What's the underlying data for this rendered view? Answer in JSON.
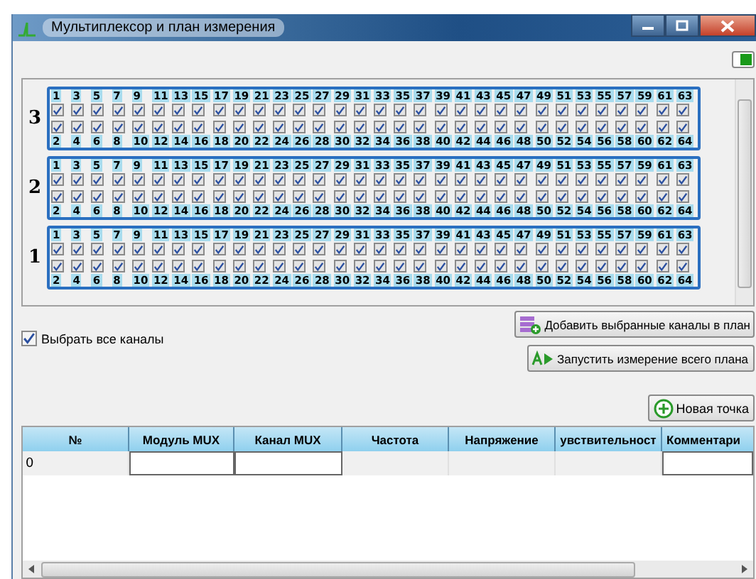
{
  "window": {
    "title": "Мультиплексор и план измерения"
  },
  "modules": [
    {
      "label": "3",
      "odd": [
        {
          "number": "1",
          "checked": true
        },
        {
          "number": "3",
          "checked": true
        },
        {
          "number": "5",
          "checked": true
        },
        {
          "number": "7",
          "checked": true
        },
        {
          "number": "9",
          "checked": true
        },
        {
          "number": "11",
          "checked": true
        },
        {
          "number": "13",
          "checked": true
        },
        {
          "number": "15",
          "checked": true
        },
        {
          "number": "17",
          "checked": true
        },
        {
          "number": "19",
          "checked": true
        },
        {
          "number": "21",
          "checked": true
        },
        {
          "number": "23",
          "checked": true
        },
        {
          "number": "25",
          "checked": true
        },
        {
          "number": "27",
          "checked": true
        },
        {
          "number": "29",
          "checked": true
        },
        {
          "number": "31",
          "checked": true
        },
        {
          "number": "33",
          "checked": true
        },
        {
          "number": "35",
          "checked": true
        },
        {
          "number": "37",
          "checked": true
        },
        {
          "number": "39",
          "checked": true
        },
        {
          "number": "41",
          "checked": true
        },
        {
          "number": "43",
          "checked": true
        },
        {
          "number": "45",
          "checked": true
        },
        {
          "number": "47",
          "checked": true
        },
        {
          "number": "49",
          "checked": true
        },
        {
          "number": "51",
          "checked": true
        },
        {
          "number": "53",
          "checked": true
        },
        {
          "number": "55",
          "checked": true
        },
        {
          "number": "57",
          "checked": true
        },
        {
          "number": "59",
          "checked": true
        },
        {
          "number": "61",
          "checked": true
        },
        {
          "number": "63",
          "checked": true
        }
      ],
      "even": [
        {
          "number": "2",
          "checked": true
        },
        {
          "number": "4",
          "checked": true
        },
        {
          "number": "6",
          "checked": true
        },
        {
          "number": "8",
          "checked": true
        },
        {
          "number": "10",
          "checked": true
        },
        {
          "number": "12",
          "checked": true
        },
        {
          "number": "14",
          "checked": true
        },
        {
          "number": "16",
          "checked": true
        },
        {
          "number": "18",
          "checked": true
        },
        {
          "number": "20",
          "checked": true
        },
        {
          "number": "22",
          "checked": true
        },
        {
          "number": "24",
          "checked": true
        },
        {
          "number": "26",
          "checked": true
        },
        {
          "number": "28",
          "checked": true
        },
        {
          "number": "30",
          "checked": true
        },
        {
          "number": "32",
          "checked": true
        },
        {
          "number": "34",
          "checked": true
        },
        {
          "number": "36",
          "checked": true
        },
        {
          "number": "38",
          "checked": true
        },
        {
          "number": "40",
          "checked": true
        },
        {
          "number": "42",
          "checked": true
        },
        {
          "number": "44",
          "checked": true
        },
        {
          "number": "46",
          "checked": true
        },
        {
          "number": "48",
          "checked": true
        },
        {
          "number": "50",
          "checked": true
        },
        {
          "number": "52",
          "checked": true
        },
        {
          "number": "54",
          "checked": true
        },
        {
          "number": "56",
          "checked": true
        },
        {
          "number": "58",
          "checked": true
        },
        {
          "number": "60",
          "checked": true
        },
        {
          "number": "62",
          "checked": true
        },
        {
          "number": "64",
          "checked": true
        }
      ]
    },
    {
      "label": "2",
      "odd": [
        {
          "number": "1",
          "checked": true
        },
        {
          "number": "3",
          "checked": true
        },
        {
          "number": "5",
          "checked": true
        },
        {
          "number": "7",
          "checked": true
        },
        {
          "number": "9",
          "checked": true
        },
        {
          "number": "11",
          "checked": true
        },
        {
          "number": "13",
          "checked": true
        },
        {
          "number": "15",
          "checked": true
        },
        {
          "number": "17",
          "checked": true
        },
        {
          "number": "19",
          "checked": true
        },
        {
          "number": "21",
          "checked": true
        },
        {
          "number": "23",
          "checked": true
        },
        {
          "number": "25",
          "checked": true
        },
        {
          "number": "27",
          "checked": true
        },
        {
          "number": "29",
          "checked": true
        },
        {
          "number": "31",
          "checked": true
        },
        {
          "number": "33",
          "checked": true
        },
        {
          "number": "35",
          "checked": true
        },
        {
          "number": "37",
          "checked": true
        },
        {
          "number": "39",
          "checked": true
        },
        {
          "number": "41",
          "checked": true
        },
        {
          "number": "43",
          "checked": true
        },
        {
          "number": "45",
          "checked": true
        },
        {
          "number": "47",
          "checked": true
        },
        {
          "number": "49",
          "checked": true
        },
        {
          "number": "51",
          "checked": true
        },
        {
          "number": "53",
          "checked": true
        },
        {
          "number": "55",
          "checked": true
        },
        {
          "number": "57",
          "checked": true
        },
        {
          "number": "59",
          "checked": true
        },
        {
          "number": "61",
          "checked": true
        },
        {
          "number": "63",
          "checked": true
        }
      ],
      "even": [
        {
          "number": "2",
          "checked": true
        },
        {
          "number": "4",
          "checked": true
        },
        {
          "number": "6",
          "checked": true
        },
        {
          "number": "8",
          "checked": true
        },
        {
          "number": "10",
          "checked": true
        },
        {
          "number": "12",
          "checked": true
        },
        {
          "number": "14",
          "checked": true
        },
        {
          "number": "16",
          "checked": true
        },
        {
          "number": "18",
          "checked": true
        },
        {
          "number": "20",
          "checked": true
        },
        {
          "number": "22",
          "checked": true
        },
        {
          "number": "24",
          "checked": true
        },
        {
          "number": "26",
          "checked": true
        },
        {
          "number": "28",
          "checked": true
        },
        {
          "number": "30",
          "checked": true
        },
        {
          "number": "32",
          "checked": true
        },
        {
          "number": "34",
          "checked": true
        },
        {
          "number": "36",
          "checked": true
        },
        {
          "number": "38",
          "checked": true
        },
        {
          "number": "40",
          "checked": true
        },
        {
          "number": "42",
          "checked": true
        },
        {
          "number": "44",
          "checked": true
        },
        {
          "number": "46",
          "checked": true
        },
        {
          "number": "48",
          "checked": true
        },
        {
          "number": "50",
          "checked": true
        },
        {
          "number": "52",
          "checked": true
        },
        {
          "number": "54",
          "checked": true
        },
        {
          "number": "56",
          "checked": true
        },
        {
          "number": "58",
          "checked": true
        },
        {
          "number": "60",
          "checked": true
        },
        {
          "number": "62",
          "checked": true
        },
        {
          "number": "64",
          "checked": true
        }
      ]
    },
    {
      "label": "1",
      "odd": [
        {
          "number": "1",
          "checked": true
        },
        {
          "number": "3",
          "checked": true
        },
        {
          "number": "5",
          "checked": true
        },
        {
          "number": "7",
          "checked": true
        },
        {
          "number": "9",
          "checked": true
        },
        {
          "number": "11",
          "checked": true
        },
        {
          "number": "13",
          "checked": true
        },
        {
          "number": "15",
          "checked": true
        },
        {
          "number": "17",
          "checked": true
        },
        {
          "number": "19",
          "checked": true
        },
        {
          "number": "21",
          "checked": true
        },
        {
          "number": "23",
          "checked": true
        },
        {
          "number": "25",
          "checked": true
        },
        {
          "number": "27",
          "checked": true
        },
        {
          "number": "29",
          "checked": true
        },
        {
          "number": "31",
          "checked": true
        },
        {
          "number": "33",
          "checked": true
        },
        {
          "number": "35",
          "checked": true
        },
        {
          "number": "37",
          "checked": true
        },
        {
          "number": "39",
          "checked": true
        },
        {
          "number": "41",
          "checked": true
        },
        {
          "number": "43",
          "checked": true
        },
        {
          "number": "45",
          "checked": true
        },
        {
          "number": "47",
          "checked": true
        },
        {
          "number": "49",
          "checked": true
        },
        {
          "number": "51",
          "checked": true
        },
        {
          "number": "53",
          "checked": true
        },
        {
          "number": "55",
          "checked": true
        },
        {
          "number": "57",
          "checked": true
        },
        {
          "number": "59",
          "checked": true
        },
        {
          "number": "61",
          "checked": true
        },
        {
          "number": "63",
          "checked": true
        }
      ],
      "even": [
        {
          "number": "2",
          "checked": true
        },
        {
          "number": "4",
          "checked": true
        },
        {
          "number": "6",
          "checked": true
        },
        {
          "number": "8",
          "checked": true
        },
        {
          "number": "10",
          "checked": true
        },
        {
          "number": "12",
          "checked": true
        },
        {
          "number": "14",
          "checked": true
        },
        {
          "number": "16",
          "checked": true
        },
        {
          "number": "18",
          "checked": true
        },
        {
          "number": "20",
          "checked": true
        },
        {
          "number": "22",
          "checked": true
        },
        {
          "number": "24",
          "checked": true
        },
        {
          "number": "26",
          "checked": true
        },
        {
          "number": "28",
          "checked": true
        },
        {
          "number": "30",
          "checked": true
        },
        {
          "number": "32",
          "checked": true
        },
        {
          "number": "34",
          "checked": true
        },
        {
          "number": "36",
          "checked": true
        },
        {
          "number": "38",
          "checked": true
        },
        {
          "number": "40",
          "checked": true
        },
        {
          "number": "42",
          "checked": true
        },
        {
          "number": "44",
          "checked": true
        },
        {
          "number": "46",
          "checked": true
        },
        {
          "number": "48",
          "checked": true
        },
        {
          "number": "50",
          "checked": true
        },
        {
          "number": "52",
          "checked": true
        },
        {
          "number": "54",
          "checked": true
        },
        {
          "number": "56",
          "checked": true
        },
        {
          "number": "58",
          "checked": true
        },
        {
          "number": "60",
          "checked": true
        },
        {
          "number": "62",
          "checked": true
        },
        {
          "number": "64",
          "checked": true
        }
      ]
    }
  ],
  "select_all": {
    "label": "Выбрать все каналы",
    "checked": true
  },
  "buttons": [
    {
      "kind": "add",
      "label": "Добавить выбранные каналы в план"
    },
    {
      "kind": "run",
      "label": "Запустить измерение всего плана"
    }
  ],
  "new_point_button": {
    "label": "Новая точка"
  },
  "table": {
    "columns": [
      "№",
      "Модуль MUX",
      "Канал MUX",
      "Частота",
      "Напряжение",
      "увствительност",
      "Комментари"
    ],
    "rows": [
      {
        "cells": [
          {
            "kind": "text",
            "value": "0"
          },
          {
            "kind": "input"
          },
          {
            "kind": "input"
          },
          {
            "kind": "empty"
          },
          {
            "kind": "empty"
          },
          {
            "kind": "empty"
          },
          {
            "kind": "input"
          }
        ]
      }
    ]
  }
}
